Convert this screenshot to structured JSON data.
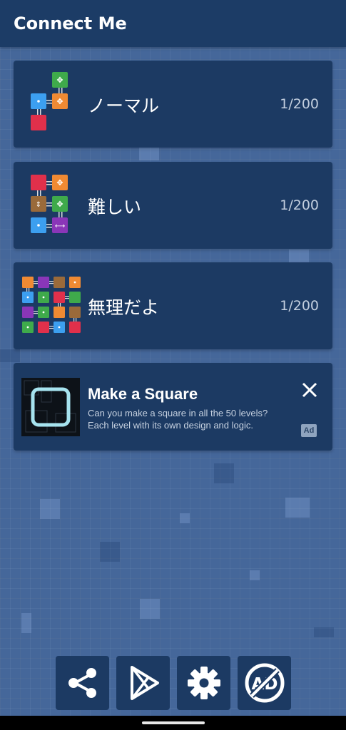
{
  "app_bar": {
    "title": "Connect Me"
  },
  "levels": [
    {
      "label": "ノーマル",
      "progress": "1/200"
    },
    {
      "label": "難しい",
      "progress": "1/200"
    },
    {
      "label": "無理だよ",
      "progress": "1/200"
    }
  ],
  "ad": {
    "title": "Make a Square",
    "description": "Can you make a square in all the 50 levels? Each level with its own design and logic.",
    "badge": "Ad"
  },
  "bottom_buttons": [
    {
      "icon": "share-icon"
    },
    {
      "icon": "play-store-icon"
    },
    {
      "icon": "gear-icon"
    },
    {
      "icon": "no-ads-icon"
    }
  ],
  "colors": {
    "background": "#45679a",
    "app_bar": "#1c3c66",
    "card": "#1c3a63",
    "text_secondary": "#c3cfdf",
    "tile_red": "#e0304b",
    "tile_orange": "#f08a33",
    "tile_green": "#3faa4b",
    "tile_blue": "#3c9ff0",
    "tile_brown": "#9a6a3a",
    "tile_purple": "#8a36b8"
  }
}
